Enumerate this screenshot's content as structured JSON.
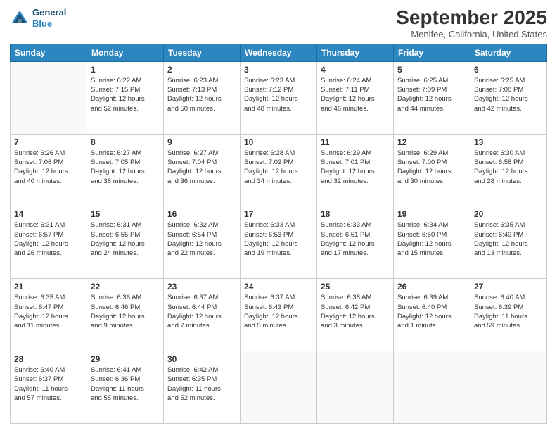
{
  "header": {
    "logo_line1": "General",
    "logo_line2": "Blue",
    "month": "September 2025",
    "location": "Menifee, California, United States"
  },
  "weekdays": [
    "Sunday",
    "Monday",
    "Tuesday",
    "Wednesday",
    "Thursday",
    "Friday",
    "Saturday"
  ],
  "weeks": [
    [
      {
        "day": "",
        "info": ""
      },
      {
        "day": "1",
        "info": "Sunrise: 6:22 AM\nSunset: 7:15 PM\nDaylight: 12 hours\nand 52 minutes."
      },
      {
        "day": "2",
        "info": "Sunrise: 6:23 AM\nSunset: 7:13 PM\nDaylight: 12 hours\nand 50 minutes."
      },
      {
        "day": "3",
        "info": "Sunrise: 6:23 AM\nSunset: 7:12 PM\nDaylight: 12 hours\nand 48 minutes."
      },
      {
        "day": "4",
        "info": "Sunrise: 6:24 AM\nSunset: 7:11 PM\nDaylight: 12 hours\nand 46 minutes."
      },
      {
        "day": "5",
        "info": "Sunrise: 6:25 AM\nSunset: 7:09 PM\nDaylight: 12 hours\nand 44 minutes."
      },
      {
        "day": "6",
        "info": "Sunrise: 6:25 AM\nSunset: 7:08 PM\nDaylight: 12 hours\nand 42 minutes."
      }
    ],
    [
      {
        "day": "7",
        "info": "Sunrise: 6:26 AM\nSunset: 7:06 PM\nDaylight: 12 hours\nand 40 minutes."
      },
      {
        "day": "8",
        "info": "Sunrise: 6:27 AM\nSunset: 7:05 PM\nDaylight: 12 hours\nand 38 minutes."
      },
      {
        "day": "9",
        "info": "Sunrise: 6:27 AM\nSunset: 7:04 PM\nDaylight: 12 hours\nand 36 minutes."
      },
      {
        "day": "10",
        "info": "Sunrise: 6:28 AM\nSunset: 7:02 PM\nDaylight: 12 hours\nand 34 minutes."
      },
      {
        "day": "11",
        "info": "Sunrise: 6:29 AM\nSunset: 7:01 PM\nDaylight: 12 hours\nand 32 minutes."
      },
      {
        "day": "12",
        "info": "Sunrise: 6:29 AM\nSunset: 7:00 PM\nDaylight: 12 hours\nand 30 minutes."
      },
      {
        "day": "13",
        "info": "Sunrise: 6:30 AM\nSunset: 6:58 PM\nDaylight: 12 hours\nand 28 minutes."
      }
    ],
    [
      {
        "day": "14",
        "info": "Sunrise: 6:31 AM\nSunset: 6:57 PM\nDaylight: 12 hours\nand 26 minutes."
      },
      {
        "day": "15",
        "info": "Sunrise: 6:31 AM\nSunset: 6:55 PM\nDaylight: 12 hours\nand 24 minutes."
      },
      {
        "day": "16",
        "info": "Sunrise: 6:32 AM\nSunset: 6:54 PM\nDaylight: 12 hours\nand 22 minutes."
      },
      {
        "day": "17",
        "info": "Sunrise: 6:33 AM\nSunset: 6:53 PM\nDaylight: 12 hours\nand 19 minutes."
      },
      {
        "day": "18",
        "info": "Sunrise: 6:33 AM\nSunset: 6:51 PM\nDaylight: 12 hours\nand 17 minutes."
      },
      {
        "day": "19",
        "info": "Sunrise: 6:34 AM\nSunset: 6:50 PM\nDaylight: 12 hours\nand 15 minutes."
      },
      {
        "day": "20",
        "info": "Sunrise: 6:35 AM\nSunset: 6:49 PM\nDaylight: 12 hours\nand 13 minutes."
      }
    ],
    [
      {
        "day": "21",
        "info": "Sunrise: 6:35 AM\nSunset: 6:47 PM\nDaylight: 12 hours\nand 11 minutes."
      },
      {
        "day": "22",
        "info": "Sunrise: 6:36 AM\nSunset: 6:46 PM\nDaylight: 12 hours\nand 9 minutes."
      },
      {
        "day": "23",
        "info": "Sunrise: 6:37 AM\nSunset: 6:44 PM\nDaylight: 12 hours\nand 7 minutes."
      },
      {
        "day": "24",
        "info": "Sunrise: 6:37 AM\nSunset: 6:43 PM\nDaylight: 12 hours\nand 5 minutes."
      },
      {
        "day": "25",
        "info": "Sunrise: 6:38 AM\nSunset: 6:42 PM\nDaylight: 12 hours\nand 3 minutes."
      },
      {
        "day": "26",
        "info": "Sunrise: 6:39 AM\nSunset: 6:40 PM\nDaylight: 12 hours\nand 1 minute."
      },
      {
        "day": "27",
        "info": "Sunrise: 6:40 AM\nSunset: 6:39 PM\nDaylight: 11 hours\nand 59 minutes."
      }
    ],
    [
      {
        "day": "28",
        "info": "Sunrise: 6:40 AM\nSunset: 6:37 PM\nDaylight: 11 hours\nand 57 minutes."
      },
      {
        "day": "29",
        "info": "Sunrise: 6:41 AM\nSunset: 6:36 PM\nDaylight: 11 hours\nand 55 minutes."
      },
      {
        "day": "30",
        "info": "Sunrise: 6:42 AM\nSunset: 6:35 PM\nDaylight: 11 hours\nand 52 minutes."
      },
      {
        "day": "",
        "info": ""
      },
      {
        "day": "",
        "info": ""
      },
      {
        "day": "",
        "info": ""
      },
      {
        "day": "",
        "info": ""
      }
    ]
  ]
}
